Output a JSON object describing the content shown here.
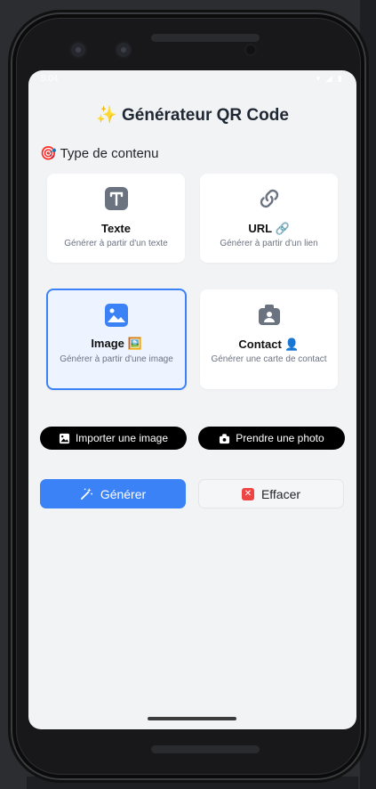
{
  "status": {
    "time": "5:04",
    "icons": "▾ ◢ ▮"
  },
  "app": {
    "title": "✨ Générateur QR Code"
  },
  "section": {
    "title": "🎯 Type de contenu"
  },
  "cards": [
    {
      "label": "Texte",
      "desc": "Générer à partir d'un texte",
      "icon": "text-icon"
    },
    {
      "label": "URL 🔗",
      "desc": "Générer à partir d'un lien",
      "icon": "link-icon"
    },
    {
      "label": "Image 🖼️",
      "desc": "Générer à partir d'une image",
      "icon": "image-icon",
      "selected": true
    },
    {
      "label": "Contact 👤",
      "desc": "Générer une carte de contact",
      "icon": "contact-icon"
    }
  ],
  "actions": {
    "import_label": "Importer une image",
    "photo_label": "Prendre une photo",
    "generate_label": "Générer",
    "clear_label": "Effacer"
  },
  "colors": {
    "accent": "#3b82f6",
    "icon": "#6b7280",
    "danger": "#ef4444"
  }
}
